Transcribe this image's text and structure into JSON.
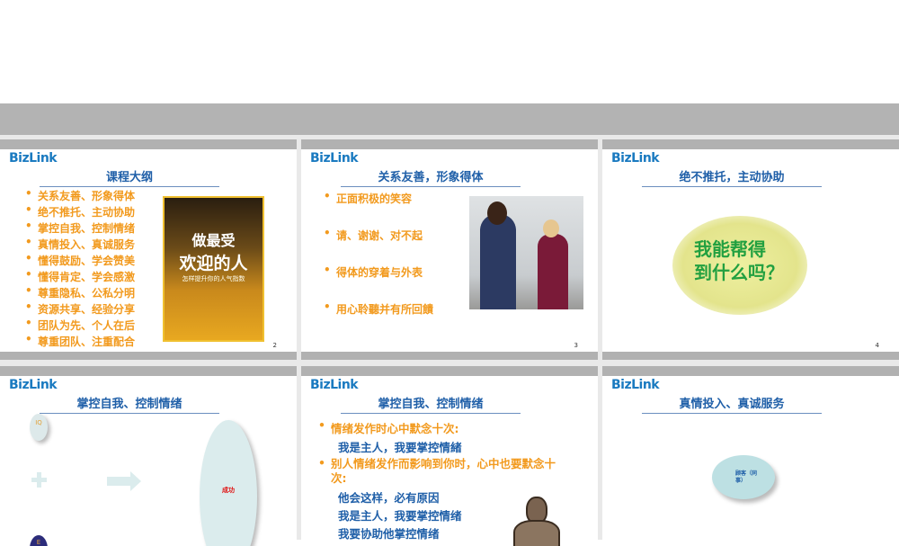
{
  "brand": "BizLink",
  "slides": [
    {
      "title": "课程大纲",
      "number": "2",
      "items": [
        "关系友善、形象得体",
        "绝不推托、主动协助",
        "掌控自我、控制情绪",
        "真情投入、真诚服务",
        "懂得鼓励、学会赞美",
        "懂得肯定、学会感激",
        "尊重隐私、公私分明",
        "资源共享、经验分享",
        "团队为先、个人在后",
        "尊重团队、注重配合"
      ],
      "book": {
        "title_line1": "做最受",
        "title_line2": "欢迎的人",
        "subtitle": "怎样提升你的人气指数"
      }
    },
    {
      "title": "关系友善，形象得体",
      "number": "3",
      "items": [
        "正面积极的笑容",
        "请、谢谢、对不起",
        "得体的穿着与外表",
        "用心聆聽并有所回饋"
      ]
    },
    {
      "title": "绝不推托，主动协助",
      "number": "4",
      "bubble": [
        "我能帮得",
        "到什么吗？"
      ]
    },
    {
      "title": "掌控自我、控制情绪",
      "iq": "IQ",
      "eq": "E",
      "success": "成功"
    },
    {
      "title": "掌控自我、控制情绪",
      "b1": "情绪发作时心中默念十次:",
      "b1_sub": "我是主人，我要掌控情緒",
      "b2": "别人情绪发作而影响到你时，心中也要默念十次:",
      "b2_subs": [
        "他会这样，必有原因",
        "我是主人，我要掌控情绪",
        "我要协助他掌控情绪"
      ]
    },
    {
      "title": "真情投入、真诚服务",
      "ellipse": "顾客（同事）"
    }
  ]
}
